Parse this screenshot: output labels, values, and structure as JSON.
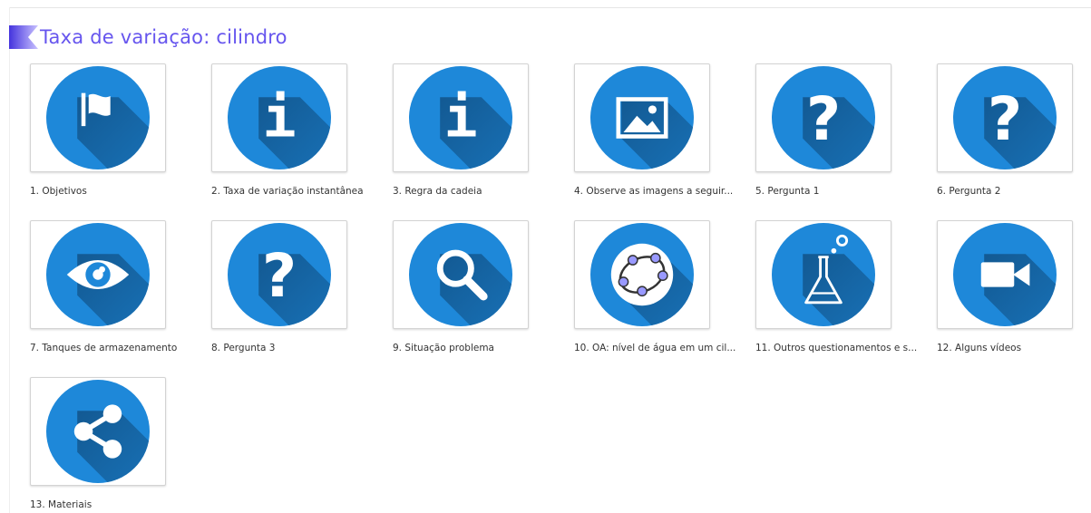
{
  "header": {
    "title": "Taxa de variação: cilindro",
    "title_color": "#6655ee"
  },
  "theme": {
    "circle_color": "#1e88d9",
    "shadow_color": "#12578f",
    "icon_color": "#ffffff"
  },
  "items": [
    {
      "label": "1. Objetivos",
      "icon": "flag-icon"
    },
    {
      "label": "2. Taxa de variação instantânea",
      "icon": "info-icon"
    },
    {
      "label": "3. Regra da cadeia",
      "icon": "info-icon"
    },
    {
      "label": "4. Observe as imagens a seguir...",
      "icon": "image-icon"
    },
    {
      "label": "5. Pergunta 1",
      "icon": "question-icon"
    },
    {
      "label": "6. Pergunta 2",
      "icon": "question-icon"
    },
    {
      "label": "7. Tanques de armazenamento",
      "icon": "eye-icon"
    },
    {
      "label": "8. Pergunta 3",
      "icon": "question-icon"
    },
    {
      "label": "9. Situação problema",
      "icon": "search-icon"
    },
    {
      "label": "10. OA: nível de água em um cil...",
      "icon": "geogebra-icon"
    },
    {
      "label": "11. Outros questionamentos e s...",
      "icon": "flask-icon"
    },
    {
      "label": "12. Alguns vídeos",
      "icon": "video-camera-icon"
    },
    {
      "label": "13. Materiais",
      "icon": "share-icon"
    }
  ]
}
